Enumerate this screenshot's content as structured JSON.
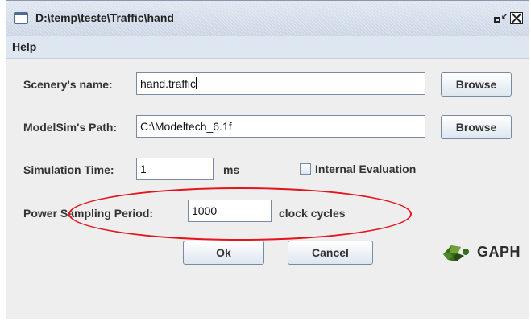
{
  "window": {
    "title": "D:\\temp\\teste\\Traffic\\hand"
  },
  "menu": {
    "items": [
      "Help"
    ]
  },
  "form": {
    "scenery_name": {
      "label": "Scenery's name:",
      "value": "hand.traffic",
      "browse_label": "Browse"
    },
    "modelsim_path": {
      "label": "ModelSim's Path:",
      "value": "C:\\Modeltech_6.1f",
      "browse_label": "Browse"
    },
    "simulation_time": {
      "label": "Simulation Time:",
      "value": "1",
      "unit": "ms"
    },
    "internal_evaluation": {
      "label": "Internal Evaluation",
      "checked": false
    },
    "power_sampling_period": {
      "label": "Power Sampling Period:",
      "value": "1000",
      "unit": "clock cycles"
    }
  },
  "buttons": {
    "ok": "Ok",
    "cancel": "Cancel"
  },
  "logo": {
    "text": "GAPH"
  },
  "colors": {
    "highlight_ellipse": "#e3141b",
    "title_bg": "#d6dfeb",
    "window_bg": "#eeeeee"
  }
}
